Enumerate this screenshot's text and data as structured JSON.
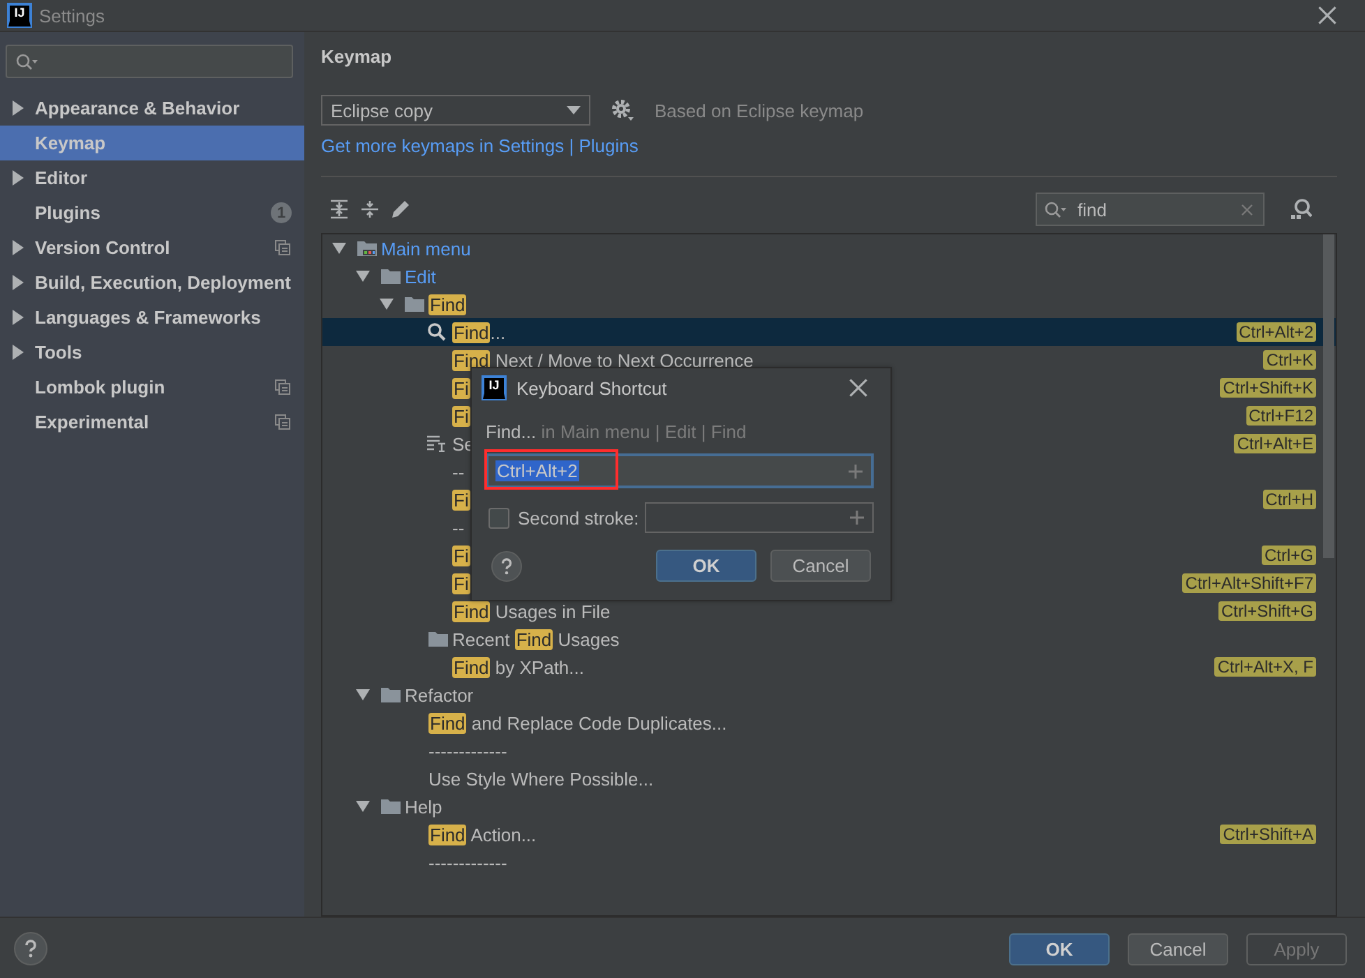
{
  "window": {
    "logo": "IJ",
    "title": "Settings"
  },
  "sidebar": {
    "items": [
      {
        "label": "Appearance & Behavior",
        "expandable": true,
        "selected": false
      },
      {
        "label": "Keymap",
        "expandable": false,
        "selected": true
      },
      {
        "label": "Editor",
        "expandable": true,
        "selected": false
      },
      {
        "label": "Plugins",
        "expandable": false,
        "selected": false,
        "badge": "1"
      },
      {
        "label": "Version Control",
        "expandable": true,
        "selected": false,
        "project_icon": true
      },
      {
        "label": "Build, Execution, Deployment",
        "expandable": true,
        "selected": false
      },
      {
        "label": "Languages & Frameworks",
        "expandable": true,
        "selected": false
      },
      {
        "label": "Tools",
        "expandable": true,
        "selected": false
      },
      {
        "label": "Lombok plugin",
        "expandable": false,
        "selected": false,
        "project_icon": true
      },
      {
        "label": "Experimental",
        "expandable": false,
        "selected": false,
        "project_icon": true
      }
    ]
  },
  "keymap": {
    "title": "Keymap",
    "scheme": "Eclipse copy",
    "based_on": "Based on Eclipse keymap",
    "link": "Get more keymaps in Settings | Plugins",
    "search": {
      "value": "find"
    },
    "tree": [
      {
        "kind": "root",
        "modified": true,
        "selected": false,
        "expanded": true,
        "segments": [
          {
            "text": "Main menu",
            "match": false
          }
        ],
        "children": [
          {
            "kind": "group",
            "modified": true,
            "selected": false,
            "expanded": true,
            "segments": [
              {
                "text": "Edit",
                "match": false
              }
            ],
            "children": [
              {
                "kind": "group",
                "modified": false,
                "selected": false,
                "expanded": true,
                "segments": [
                  {
                    "text": "Find",
                    "match": true
                  }
                ],
                "children": [
                  {
                    "kind": "search",
                    "modified": false,
                    "selected": true,
                    "segments": [
                      {
                        "text": "Find",
                        "match": true
                      },
                      {
                        "text": "...",
                        "match": false
                      }
                    ],
                    "shortcut": "Ctrl+Alt+2"
                  },
                  {
                    "kind": "action",
                    "modified": false,
                    "selected": false,
                    "segments": [
                      {
                        "text": "Find",
                        "match": true
                      },
                      {
                        "text": " Next / Move to Next Occurrence",
                        "match": false
                      }
                    ],
                    "shortcut": "Ctrl+K"
                  },
                  {
                    "kind": "action",
                    "modified": false,
                    "selected": false,
                    "segments": [
                      {
                        "text": "Fi",
                        "match": true
                      }
                    ],
                    "shortcut": "Ctrl+Shift+K"
                  },
                  {
                    "kind": "action",
                    "modified": false,
                    "selected": false,
                    "segments": [
                      {
                        "text": "Fi",
                        "match": true
                      }
                    ],
                    "shortcut": "Ctrl+F12"
                  },
                  {
                    "kind": "text",
                    "modified": false,
                    "selected": false,
                    "segments": [
                      {
                        "text": "Se",
                        "match": false
                      }
                    ],
                    "shortcut": "Ctrl+Alt+E"
                  },
                  {
                    "kind": "action",
                    "modified": false,
                    "selected": false,
                    "segments": [
                      {
                        "text": "--",
                        "match": false
                      }
                    ]
                  },
                  {
                    "kind": "action",
                    "modified": false,
                    "selected": false,
                    "segments": [
                      {
                        "text": "Fi",
                        "match": true
                      }
                    ],
                    "shortcut": "Ctrl+H"
                  },
                  {
                    "kind": "action",
                    "modified": false,
                    "selected": false,
                    "segments": [
                      {
                        "text": "--",
                        "match": false
                      }
                    ]
                  },
                  {
                    "kind": "action",
                    "modified": false,
                    "selected": false,
                    "segments": [
                      {
                        "text": "Fi",
                        "match": true
                      }
                    ],
                    "shortcut": "Ctrl+G"
                  },
                  {
                    "kind": "action",
                    "modified": false,
                    "selected": false,
                    "segments": [
                      {
                        "text": "Fi",
                        "match": true
                      }
                    ],
                    "shortcut": "Ctrl+Alt+Shift+F7"
                  },
                  {
                    "kind": "action",
                    "modified": false,
                    "selected": false,
                    "segments": [
                      {
                        "text": "Find",
                        "match": true
                      },
                      {
                        "text": " Usages in File",
                        "match": false
                      }
                    ],
                    "shortcut": "Ctrl+Shift+G"
                  },
                  {
                    "kind": "group",
                    "modified": false,
                    "selected": false,
                    "segments": [
                      {
                        "text": "Recent ",
                        "match": false
                      },
                      {
                        "text": "Find",
                        "match": true
                      },
                      {
                        "text": " Usages",
                        "match": false
                      }
                    ]
                  },
                  {
                    "kind": "action",
                    "modified": false,
                    "selected": false,
                    "segments": [
                      {
                        "text": "Find",
                        "match": true
                      },
                      {
                        "text": " by XPath...",
                        "match": false
                      }
                    ],
                    "shortcut": "Ctrl+Alt+X, F"
                  }
                ]
              }
            ]
          },
          {
            "kind": "group",
            "modified": false,
            "selected": false,
            "expanded": true,
            "segments": [
              {
                "text": "Refactor",
                "match": false
              }
            ],
            "children": [
              {
                "kind": "action",
                "modified": false,
                "selected": false,
                "segments": [
                  {
                    "text": "Find",
                    "match": true
                  },
                  {
                    "text": " and Replace Code Duplicates...",
                    "match": false
                  }
                ]
              },
              {
                "kind": "action",
                "modified": false,
                "selected": false,
                "segments": [
                  {
                    "text": "-------------",
                    "match": false
                  }
                ]
              },
              {
                "kind": "action",
                "modified": false,
                "selected": false,
                "segments": [
                  {
                    "text": "Use Style Where Possible...",
                    "match": false
                  }
                ]
              }
            ]
          },
          {
            "kind": "group",
            "modified": false,
            "selected": false,
            "expanded": true,
            "segments": [
              {
                "text": "Help",
                "match": false
              }
            ],
            "children": [
              {
                "kind": "action",
                "modified": false,
                "selected": false,
                "segments": [
                  {
                    "text": "Find",
                    "match": true
                  },
                  {
                    "text": " Action...",
                    "match": false
                  }
                ],
                "shortcut": "Ctrl+Shift+A"
              },
              {
                "kind": "action",
                "modified": false,
                "selected": false,
                "segments": [
                  {
                    "text": "-------------",
                    "match": false
                  }
                ]
              }
            ]
          }
        ]
      }
    ]
  },
  "dialog": {
    "logo": "IJ",
    "title": "Keyboard Shortcut",
    "action": "Find...",
    "path": "in Main menu | Edit | Find",
    "first_stroke": {
      "value": "Ctrl+Alt+2",
      "selected": true,
      "marked": true
    },
    "second_stroke": {
      "label": "Second stroke:",
      "checked": false
    },
    "buttons": [
      {
        "label": "OK",
        "default": true
      },
      {
        "label": "Cancel",
        "default": false
      }
    ]
  },
  "footer": {
    "buttons": [
      {
        "label": "OK",
        "kind": "default",
        "disabled": false
      },
      {
        "label": "Cancel",
        "kind": "normal",
        "disabled": false
      },
      {
        "label": "Apply",
        "kind": "normal",
        "disabled": true
      }
    ]
  }
}
